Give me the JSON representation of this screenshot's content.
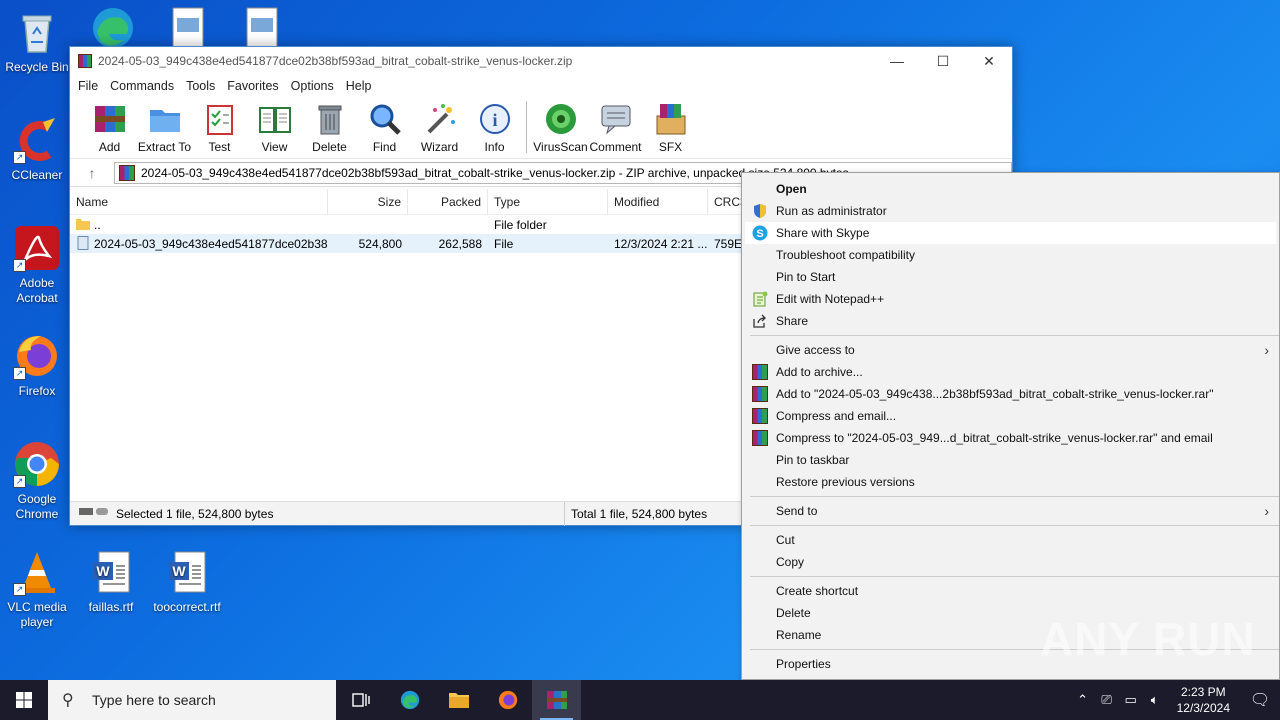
{
  "desktop": {
    "icons": [
      {
        "label": "Recycle Bin"
      },
      {
        "label": "CCleaner"
      },
      {
        "label": "Adobe Acrobat"
      },
      {
        "label": "Firefox"
      },
      {
        "label": "Google Chrome"
      },
      {
        "label": "VLC media player"
      },
      {
        "label": "faillas.rtf"
      },
      {
        "label": "toocorrect.rtf"
      }
    ]
  },
  "window": {
    "title": "2024-05-03_949c438e4ed541877dce02b38bf593ad_bitrat_cobalt-strike_venus-locker.zip",
    "menu": [
      "File",
      "Commands",
      "Tools",
      "Favorites",
      "Options",
      "Help"
    ],
    "toolbar": [
      "Add",
      "Extract To",
      "Test",
      "View",
      "Delete",
      "Find",
      "Wizard",
      "Info",
      "VirusScan",
      "Comment",
      "SFX"
    ],
    "address": "2024-05-03_949c438e4ed541877dce02b38bf593ad_bitrat_cobalt-strike_venus-locker.zip - ZIP archive, unpacked size 524,800 bytes",
    "columns": [
      "Name",
      "Size",
      "Packed",
      "Type",
      "Modified",
      "CRC32"
    ],
    "rows": [
      {
        "name": "..",
        "size": "",
        "packed": "",
        "type": "File folder",
        "modified": "",
        "crc": ""
      },
      {
        "name": "2024-05-03_949c438e4ed541877dce02b38b...",
        "size": "524,800",
        "packed": "262,588",
        "type": "File",
        "modified": "12/3/2024 2:21 ...",
        "crc": "759E9"
      }
    ],
    "status_left": "Selected 1 file, 524,800 bytes",
    "status_right": "Total 1 file, 524,800 bytes"
  },
  "context_menu": {
    "open": "Open",
    "run_admin": "Run as administrator",
    "share_skype": "Share with Skype",
    "troubleshoot": "Troubleshoot compatibility",
    "pin_start": "Pin to Start",
    "edit_notepad": "Edit with Notepad++",
    "share": "Share",
    "give_access": "Give access to",
    "add_archive": "Add to archive...",
    "add_to_rar": "Add to \"2024-05-03_949c438...2b38bf593ad_bitrat_cobalt-strike_venus-locker.rar\"",
    "compress_email": "Compress and email...",
    "compress_to_rar_email": "Compress to \"2024-05-03_949...d_bitrat_cobalt-strike_venus-locker.rar\" and email",
    "pin_taskbar": "Pin to taskbar",
    "restore_versions": "Restore previous versions",
    "send_to": "Send to",
    "cut": "Cut",
    "copy": "Copy",
    "create_shortcut": "Create shortcut",
    "delete": "Delete",
    "rename": "Rename",
    "properties": "Properties"
  },
  "watermark": "ANY RUN",
  "taskbar": {
    "search_placeholder": "Type here to search",
    "time": "2:23 PM",
    "date": "12/3/2024"
  }
}
